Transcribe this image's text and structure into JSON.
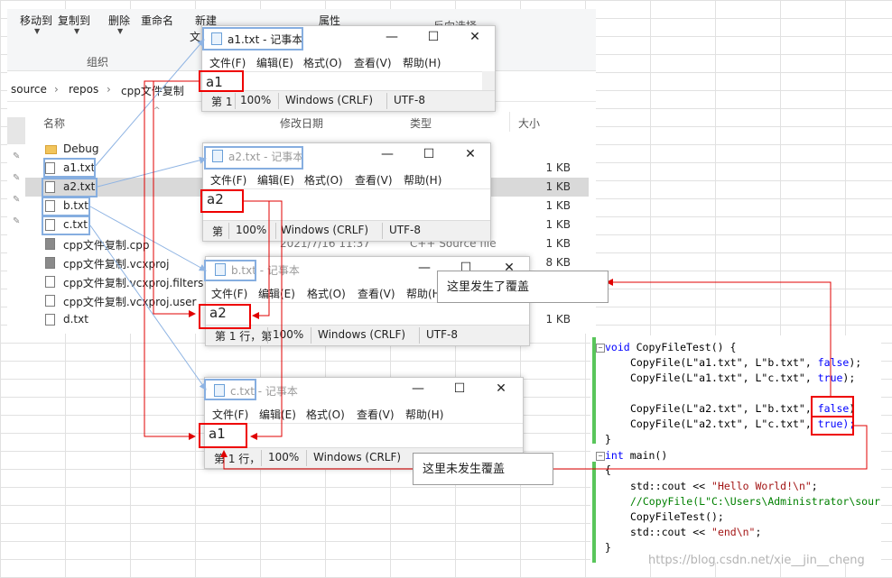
{
  "ribbon": {
    "move_to": "移动到",
    "copy_to": "复制到",
    "delete": "删除",
    "rename": "重命名",
    "new": "新建",
    "new2": "文",
    "organize": "组织",
    "properties": "属性",
    "invert_selection": "反向选择"
  },
  "breadcrumb": [
    "source",
    "repos",
    "cpp文件复制"
  ],
  "breadcrumb_sep": "›",
  "columns": {
    "name": "名称",
    "date": "修改日期",
    "type": "类型",
    "size": "大小"
  },
  "files": [
    {
      "name": "Debug",
      "size": "",
      "date": "",
      "type": ""
    },
    {
      "name": "a1.txt",
      "size": "1 KB",
      "date": "",
      "type": ""
    },
    {
      "name": "a2.txt",
      "size": "1 KB",
      "date": "",
      "type": ""
    },
    {
      "name": "b.txt",
      "size": "1 KB",
      "date": "",
      "type": ""
    },
    {
      "name": "c.txt",
      "size": "1 KB",
      "date": "",
      "type": ""
    },
    {
      "name": "cpp文件复制.cpp",
      "size": "1 KB",
      "date": "2021/7/16 11:37",
      "type": "C++ Source file"
    },
    {
      "name": "cpp文件复制.vcxproj",
      "size": "8 KB",
      "date": "",
      "type": ""
    },
    {
      "name": "cpp文件复制.vcxproj.filters",
      "size": "",
      "date": "",
      "type": ""
    },
    {
      "name": "cpp文件复制.vcxproj.user",
      "size": "",
      "date": "",
      "type": ""
    },
    {
      "name": "d.txt",
      "size": "1 KB",
      "date": "",
      "type": ""
    }
  ],
  "notepad_menu": [
    "文件(F)",
    "编辑(E)",
    "格式(O)",
    "查看(V)",
    "帮助(H)"
  ],
  "notepads": [
    {
      "title_name": "a1.txt",
      "title_suffix": " - 记事本",
      "content": "a1",
      "pos": "第 1",
      "zoom": "100%",
      "eol": "Windows (CRLF)",
      "enc": "UTF-8"
    },
    {
      "title_name": "a2.txt",
      "title_suffix": " - 记事本",
      "content": "a2",
      "pos": "第",
      "zoom": "100%",
      "eol": "Windows (CRLF)",
      "enc": "UTF-8"
    },
    {
      "title_name": "b.txt",
      "title_suffix": " - 记事本",
      "content": "a2",
      "pos": "第 1 行，第",
      "zoom": "100%",
      "eol": "Windows (CRLF)",
      "enc": "UTF-8"
    },
    {
      "title_name": "c.txt",
      "title_suffix": " - 记事本",
      "content": "a1",
      "pos": "第 1 行，",
      "zoom": "100%",
      "eol": "Windows (CRLF)",
      "enc": ""
    }
  ],
  "window_controls": {
    "minimize": "—",
    "maximize": "☐",
    "close": "✕"
  },
  "callouts": {
    "overwritten": "这里发生了覆盖",
    "not_overwritten": "这里未发生覆盖"
  },
  "code": {
    "l1_kw": "void",
    "l1_rest": " CopyFileTest() {",
    "l2": [
      "CopyFile(L\"a1.txt\", L\"b.txt\", ",
      "false",
      ");"
    ],
    "l3": [
      "CopyFile(L\"a1.txt\", L\"c.txt\", ",
      "true",
      ");"
    ],
    "l4": [
      "CopyFile(L\"a2.txt\", L\"b.txt\", ",
      "false",
      ")"
    ],
    "l5": [
      "CopyFile(L\"a2.txt\", L\"c.txt\", ",
      "true);",
      ""
    ],
    "l6": "}",
    "l7_kw": "int",
    "l7_rest": " main()",
    "l8": "{",
    "l9_a": "std::cout << ",
    "l9_str": "\"Hello World!\\n\"",
    "l9_b": ";",
    "l10": "//CopyFile(L\"C:\\Users\\Administrator\\source",
    "l11": "CopyFileTest();",
    "l12_a": "std::cout << ",
    "l12_str": "\"end\\n\"",
    "l12_b": ";",
    "l13": "}"
  },
  "watermark": "https://blog.csdn.net/xie__jin__cheng",
  "colors": {
    "highlight_red": "#e00000",
    "highlight_blue": "#86aee0",
    "arrow_blue": "#8fb4e3"
  }
}
